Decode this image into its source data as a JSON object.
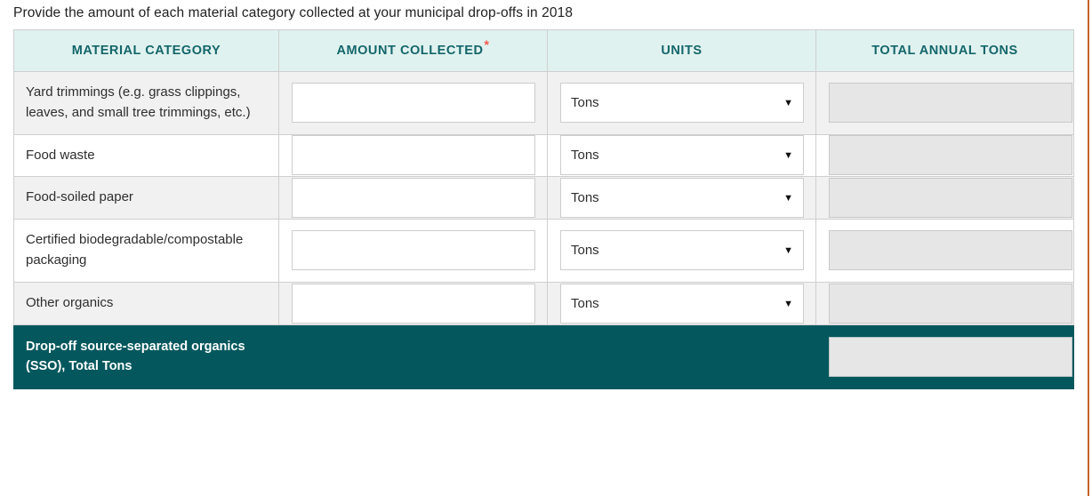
{
  "form": {
    "prompt": "Provide the amount of each material category collected at your municipal drop-offs in 2018",
    "required_marker": "*",
    "accent_teal": "#04585d",
    "header_bg": "#e0f2ef",
    "header_text_color": "#13666b",
    "required_color": "#f2584c",
    "edge_rule_color": "#c4652a"
  },
  "table": {
    "columns": [
      {
        "label": "MATERIAL CATEGORY",
        "required": false
      },
      {
        "label": "AMOUNT COLLECTED",
        "required": true
      },
      {
        "label": "UNITS",
        "required": false
      },
      {
        "label": "TOTAL ANNUAL TONS",
        "required": false
      }
    ],
    "rows": [
      {
        "category": "Yard trimmings (e.g. grass clippings, leaves, and small tree trimmings, etc.)",
        "amount_value": "",
        "amount_placeholder": "",
        "units_value": "Tons",
        "units_caret": "chevron-down-icon",
        "total_value": ""
      },
      {
        "category": "Food waste",
        "amount_value": "",
        "amount_placeholder": "",
        "units_value": "Tons",
        "units_caret": "chevron-down-icon",
        "total_value": ""
      },
      {
        "category": "Food-soiled paper",
        "amount_value": "",
        "amount_placeholder": "",
        "units_value": "Tons",
        "units_caret": "chevron-down-icon",
        "total_value": ""
      },
      {
        "category": "Certified biodegradable/compostable packaging",
        "amount_value": "",
        "amount_placeholder": "",
        "units_value": "Tons",
        "units_caret": "chevron-down-icon",
        "total_value": ""
      },
      {
        "category": "Other organics",
        "amount_value": "",
        "amount_placeholder": "",
        "units_value": "Tons",
        "units_caret": "chevron-down-icon",
        "total_value": ""
      }
    ],
    "total_row": {
      "label": "Drop-off source-separated organics (SSO), Total Tons",
      "total_value": ""
    }
  }
}
